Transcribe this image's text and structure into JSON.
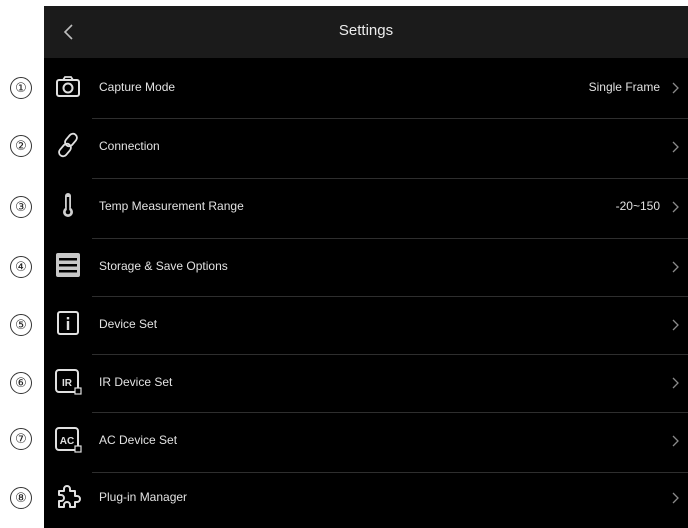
{
  "header": {
    "title": "Settings",
    "back_icon": "chevron-left-icon"
  },
  "callouts": [
    "①",
    "②",
    "③",
    "④",
    "⑤",
    "⑥",
    "⑦",
    "⑧"
  ],
  "rows": [
    {
      "label": "Capture Mode",
      "value": "Single Frame",
      "icon": "camera-icon"
    },
    {
      "label": "Connection",
      "value": "",
      "icon": "link-icon"
    },
    {
      "label": "Temp Measurement Range",
      "value": "-20~150",
      "icon": "thermometer-icon"
    },
    {
      "label": "Storage & Save Options",
      "value": "",
      "icon": "storage-icon"
    },
    {
      "label": "Device Set",
      "value": "",
      "icon": "info-icon"
    },
    {
      "label": "IR Device Set",
      "value": "",
      "icon": "ir-badge-icon"
    },
    {
      "label": "AC Device Set",
      "value": "",
      "icon": "ac-badge-icon"
    },
    {
      "label": "Plug-in Manager",
      "value": "",
      "icon": "plugin-icon"
    }
  ],
  "colors": {
    "background": "#000000",
    "header": "#1b1b1b",
    "text": "#e2e2e2",
    "chevron": "#8a8a8a"
  }
}
